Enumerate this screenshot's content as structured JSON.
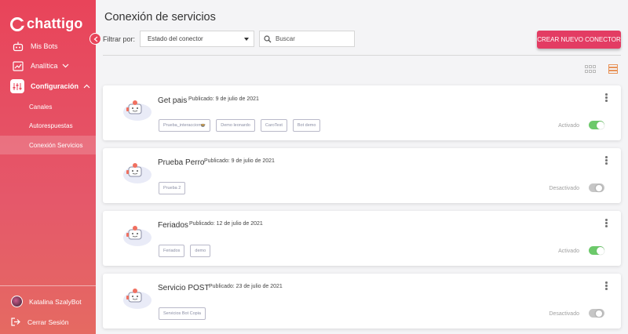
{
  "app": {
    "brand": "chattigo"
  },
  "sidebar": {
    "items": [
      {
        "label": "Mis Bots",
        "icon": "bot-icon"
      },
      {
        "label": "Analítica",
        "icon": "analytics-icon"
      },
      {
        "label": "Configuración",
        "icon": "settings-sliders-icon"
      }
    ],
    "subitems": [
      "Canales",
      "Autorespuestas",
      "Conexión Servicios"
    ],
    "user_name": "Katalina SzalyBot",
    "logout_label": "Cerrar Sesión"
  },
  "page": {
    "title": "Conexión de servicios",
    "filter_label": "Filtrar por:",
    "filter_value": "Estado del conector",
    "search_placeholder": "Buscar",
    "create_label": "CREAR NUEVO CONECTOR"
  },
  "connectors": [
    {
      "name": "Get pais",
      "date": "Publicado: 9 de julio de 2021",
      "tags": [
        "Prueba_interaccion🍲",
        "Demo leonardo",
        "CaroTest",
        "Bot demo"
      ],
      "status": "Activado",
      "active": true
    },
    {
      "name": "Prueba Perro",
      "date": "Publicado: 9 de julio de 2021",
      "tags": [
        "Prueba 2"
      ],
      "status": "Desactivado",
      "active": false
    },
    {
      "name": "Feriados",
      "date": "Publicado: 12 de julio de 2021",
      "tags": [
        "Feriados",
        "demo"
      ],
      "status": "Activado",
      "active": true
    },
    {
      "name": "Servicio POST",
      "date": "Publicado: 23 de julio de 2021",
      "tags": [
        "Servicios Bot Copia"
      ],
      "status": "Desactivado",
      "active": false
    }
  ],
  "colors": {
    "brand": "#e8445a",
    "accent_button": "#e33c63",
    "toggle_on": "#6cc96a",
    "toggle_off": "#c6c6c6"
  }
}
